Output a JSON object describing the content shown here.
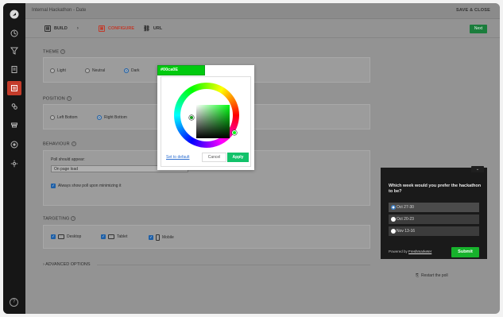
{
  "app": {
    "title": "Internal Hackathon - Date",
    "save_close": "SAVE & CLOSE"
  },
  "steps": [
    {
      "label": "BUILD",
      "icon": "build-icon",
      "state": "done"
    },
    {
      "label": "CONFIGURE",
      "icon": "configure-icon",
      "state": "active"
    },
    {
      "label": "URL",
      "icon": "link-icon",
      "state": "pending"
    }
  ],
  "next_label": "Next",
  "theme": {
    "label": "THEME",
    "options": [
      "Light",
      "Neutral",
      "Dark"
    ],
    "selected": "Dark"
  },
  "position": {
    "label": "POSITION",
    "options": [
      "Left Bottom",
      "Right Bottom"
    ],
    "selected": "Right Bottom"
  },
  "behaviour": {
    "label": "BEHAVIOUR",
    "poll_appear_label": "Poll should appear:",
    "poll_appear_value": "On page load",
    "always_show_label": "Always show poll upon minimizing it",
    "always_show_checked": true
  },
  "targeting": {
    "label": "TARGETING",
    "devices": [
      {
        "label": "Desktop",
        "checked": true
      },
      {
        "label": "Tablet",
        "checked": true
      },
      {
        "label": "Mobile",
        "checked": true
      }
    ]
  },
  "advanced_label": "ADVANCED OPTIONS",
  "color_picker": {
    "hex": "#00ca0E",
    "set_default": "Set to default",
    "cancel": "Cancel",
    "apply": "Apply",
    "accent": "#00ca0e"
  },
  "poll_preview": {
    "question": "Which week would you prefer the hackathon to be?",
    "options": [
      "Oct 27-30",
      "Oct 20-23",
      "Nov 13-16"
    ],
    "selected": "Oct 27-30",
    "powered_prefix": "Powered by",
    "powered_brand": "Freshmarketer",
    "submit": "Submit"
  },
  "restart_label": "Restart the poll",
  "colors": {
    "sidebar": "#161616",
    "active_nav": "#c43c2b",
    "brand_green": "#17b22c",
    "overlay": "#939393"
  }
}
